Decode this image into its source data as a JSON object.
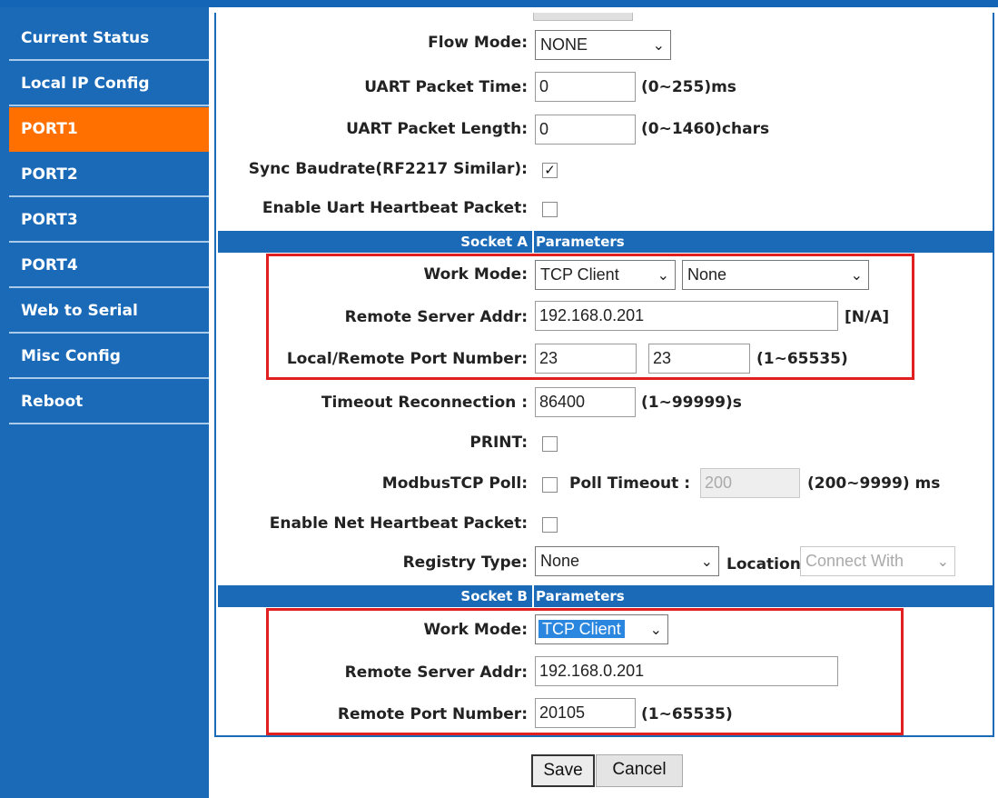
{
  "nav": {
    "items": [
      {
        "label": "Current Status"
      },
      {
        "label": "Local IP Config"
      },
      {
        "label": "PORT1"
      },
      {
        "label": "PORT2"
      },
      {
        "label": "PORT3"
      },
      {
        "label": "PORT4"
      },
      {
        "label": "Web to Serial"
      },
      {
        "label": "Misc Config"
      },
      {
        "label": "Reboot"
      }
    ],
    "active": "PORT1"
  },
  "uart": {
    "flow_mode_label": "Flow Mode:",
    "flow_mode_value": "NONE",
    "packet_time_label": "UART Packet Time:",
    "packet_time_value": "0",
    "packet_time_hint": "(0~255)ms",
    "packet_length_label": "UART Packet Length:",
    "packet_length_value": "0",
    "packet_length_hint": "(0~1460)chars",
    "sync_baud_label": "Sync Baudrate(RF2217 Similar):",
    "sync_baud_checked": true,
    "uart_heartbeat_label": "Enable Uart Heartbeat Packet:",
    "uart_heartbeat_checked": false
  },
  "socket_a": {
    "header_left": "Socket A",
    "header_right": "Parameters",
    "work_mode_label": "Work Mode:",
    "work_mode_value": "TCP Client",
    "work_mode_secondary": "None",
    "remote_addr_label": "Remote Server Addr:",
    "remote_addr_value": "192.168.0.201",
    "remote_addr_hint": "[N/A]",
    "port_label": "Local/Remote Port Number:",
    "local_port": "23",
    "remote_port": "23",
    "port_hint": "(1~65535)",
    "timeout_label": "Timeout Reconnection :",
    "timeout_value": "86400",
    "timeout_hint": "(1~99999)s",
    "print_label": "PRINT:",
    "print_checked": false,
    "modbus_label": "ModbusTCP Poll:",
    "modbus_checked": false,
    "poll_timeout_label": "Poll Timeout :",
    "poll_timeout_value": "200",
    "poll_timeout_hint": "(200~9999) ms",
    "net_heartbeat_label": "Enable Net Heartbeat Packet:",
    "net_heartbeat_checked": false,
    "registry_label": "Registry Type:",
    "registry_value": "None",
    "location_label": "Location",
    "location_value": "Connect With"
  },
  "socket_b": {
    "header_left": "Socket B",
    "header_right": "Parameters",
    "work_mode_label": "Work Mode:",
    "work_mode_value": "TCP Client",
    "remote_addr_label": "Remote Server Addr:",
    "remote_addr_value": "192.168.0.201",
    "remote_port_label": "Remote Port Number:",
    "remote_port_value": "20105",
    "remote_port_hint": "(1~65535)"
  },
  "actions": {
    "save": "Save",
    "cancel": "Cancel"
  },
  "colors": {
    "nav_bg": "#1a6ab8",
    "nav_active": "#ff7000",
    "highlight_box": "#e02020",
    "selected_option": "#2a86de"
  }
}
